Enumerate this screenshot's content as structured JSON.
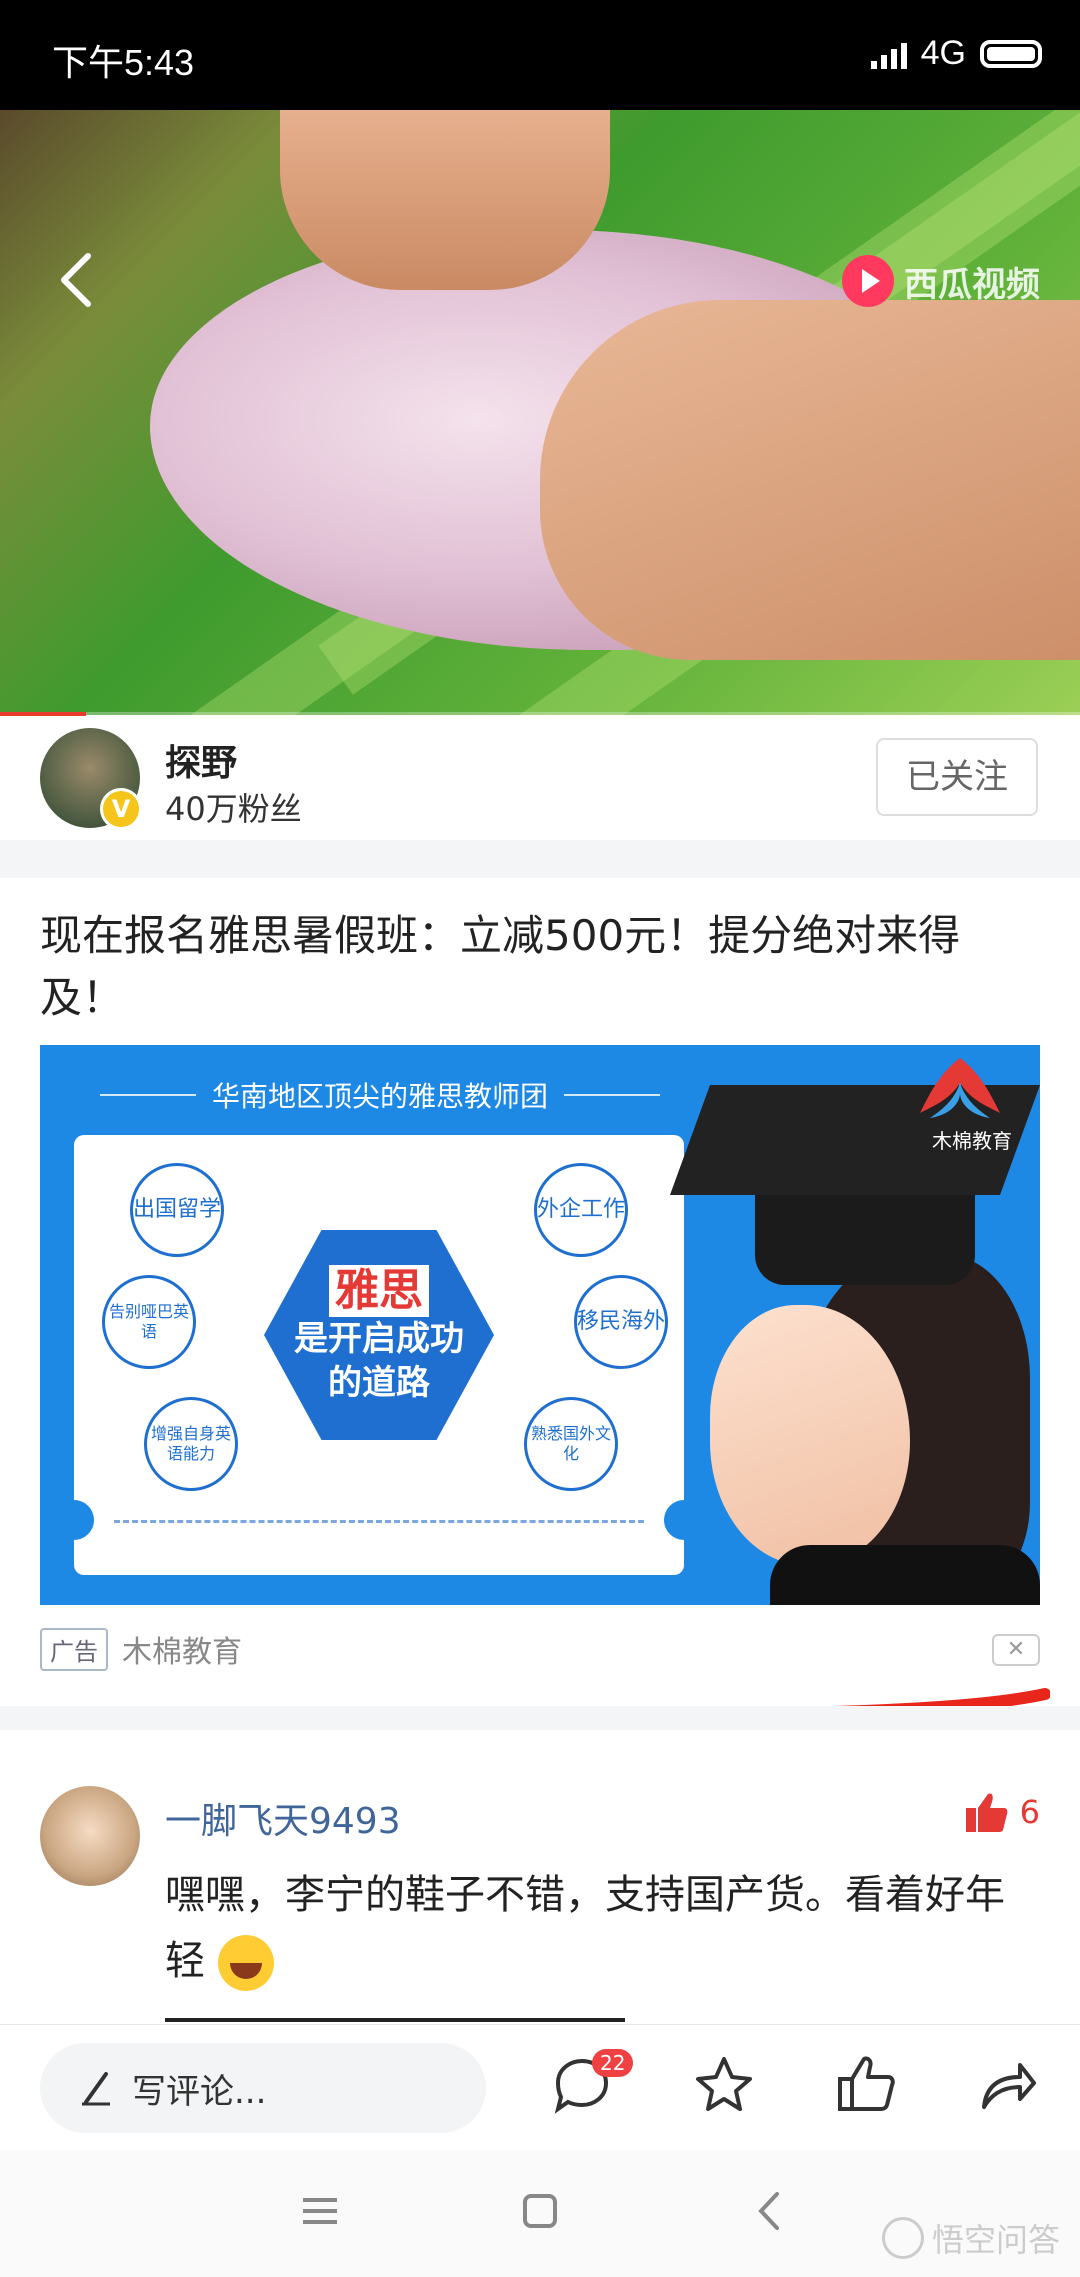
{
  "status_bar": {
    "time": "下午5:43",
    "network": "4G"
  },
  "video": {
    "brand": "西瓜视频",
    "progress_fraction": 0.08
  },
  "author": {
    "name": "探野",
    "fans": "40万粉丝",
    "badge": "V",
    "follow_label": "已关注"
  },
  "ad": {
    "title": "现在报名雅思暑假班：立减500元！提分绝对来得及！",
    "banner": {
      "headline": "华南地区顶尖的雅思教师团",
      "center_main": "雅思",
      "center_sub": "是开启成功的道路",
      "bubbles": [
        "出国留学",
        "外企工作",
        "告别哑巴英语",
        "移民海外",
        "增强自身英语能力",
        "熟悉国外文化"
      ],
      "logo": "木棉教育"
    },
    "tag": "广告",
    "source": "木棉教育",
    "close": "✕"
  },
  "comment": {
    "user": "一脚飞天9493",
    "likes": "6",
    "text": "嘿嘿，李宁的鞋子不错，支持国产货。看着好年轻"
  },
  "bottom_bar": {
    "placeholder": "写评论...",
    "comment_count": "22"
  },
  "watermark": "悟空问答",
  "colors": {
    "accent_red": "#e53935",
    "banner_blue": "#1e88e5",
    "link_blue": "#406599"
  }
}
